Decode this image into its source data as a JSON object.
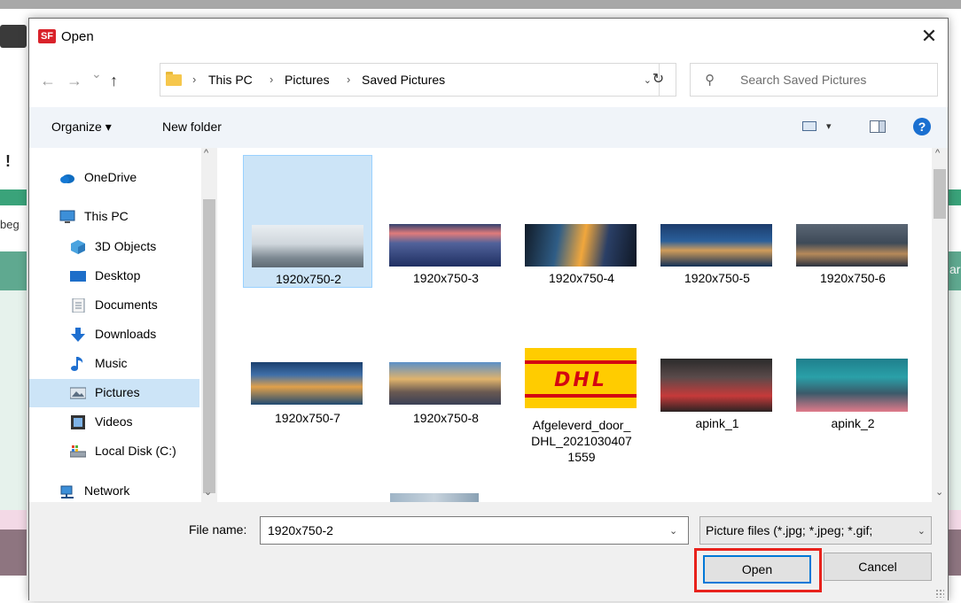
{
  "dialog": {
    "app_icon_text": "SF",
    "title": "Open",
    "close_glyph": "✕"
  },
  "background": {
    "fragment_excl": "!",
    "fragment_beg": "beg",
    "fragment_ar": "ar"
  },
  "nav": {
    "back_glyph": "←",
    "forward_glyph": "→",
    "recent_glyph": "⌄",
    "up_glyph": "↑",
    "breadcrumb": [
      "This PC",
      "Pictures",
      "Saved Pictures"
    ],
    "separator": "›",
    "dropdown_glyph": "⌄",
    "refresh_glyph": "↻"
  },
  "search": {
    "placeholder": "Search Saved Pictures",
    "icon": "search-icon"
  },
  "toolbar": {
    "organize_label": "Organize ▾",
    "new_folder_label": "New folder",
    "view_dd_glyph": "▾",
    "help_glyph": "?"
  },
  "sidebar": {
    "items": [
      {
        "label": "OneDrive",
        "icon": "cloud-icon"
      },
      {
        "label": "This PC",
        "icon": "monitor-icon"
      },
      {
        "label": "3D Objects",
        "icon": "cube-icon"
      },
      {
        "label": "Desktop",
        "icon": "desktop-icon"
      },
      {
        "label": "Documents",
        "icon": "document-icon"
      },
      {
        "label": "Downloads",
        "icon": "download-arrow-icon"
      },
      {
        "label": "Music",
        "icon": "music-note-icon"
      },
      {
        "label": "Pictures",
        "icon": "pictures-icon",
        "selected": true
      },
      {
        "label": "Videos",
        "icon": "film-icon"
      },
      {
        "label": "Local Disk (C:)",
        "icon": "drive-icon"
      },
      {
        "label": "Network",
        "icon": "network-icon"
      }
    ],
    "scroll_up_glyph": "^",
    "scroll_down_glyph": "⌄"
  },
  "files": [
    {
      "name": "1920x750-2",
      "selected": true
    },
    {
      "name": "1920x750-3"
    },
    {
      "name": "1920x750-4"
    },
    {
      "name": "1920x750-5"
    },
    {
      "name": "1920x750-6"
    },
    {
      "name": "1920x750-7"
    },
    {
      "name": "1920x750-8"
    },
    {
      "name_lines": [
        "Afgeleverd_door_",
        "DHL_2021030407",
        "1559"
      ],
      "thumb_text": "DHL"
    },
    {
      "name": "apink_1"
    },
    {
      "name": "apink_2"
    },
    {
      "name": ""
    }
  ],
  "bottom": {
    "file_name_label": "File name:",
    "file_name_value": "1920x750-2",
    "file_name_dd_glyph": "⌄",
    "filter_label": "Picture files (*.jpg; *.jpeg; *.gif;",
    "filter_dd_glyph": "⌄",
    "open_label": "Open",
    "cancel_label": "Cancel"
  },
  "colors": {
    "accent": "#0078d7",
    "selection": "#cce4f7",
    "highlight_box": "#e8221c",
    "toolbar_bg": "#f0f4f9"
  }
}
